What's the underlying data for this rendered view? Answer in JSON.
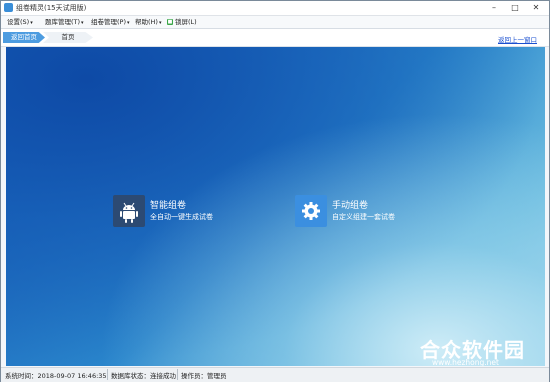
{
  "window": {
    "title": "组卷精灵(15天试用版)",
    "min_glyph": "–",
    "max_glyph": "□",
    "close_glyph": "✕"
  },
  "menu": [
    {
      "label": "设置(S)",
      "arrow": "▾"
    },
    {
      "label": "题库管理(T)",
      "arrow": "▾"
    },
    {
      "label": "组卷管理(P)",
      "arrow": "▾"
    },
    {
      "label": "帮助(H)",
      "arrow": "▾"
    },
    {
      "label": "锁屏(L)",
      "icon": "lock-icon"
    }
  ],
  "nav": {
    "home_crumb": "返回首页",
    "current_crumb": "首页",
    "back_link": "返回上一窗口"
  },
  "tiles": [
    {
      "title": "智能组卷",
      "subtitle": "全自动一键生成试卷",
      "icon": "android-icon",
      "color": "#2c4a73"
    },
    {
      "title": "手动组卷",
      "subtitle": "自定义组建一套试卷",
      "icon": "gear-icon",
      "color": "#3b8fe0"
    }
  ],
  "watermark": {
    "text": "合众软件园",
    "url": "www.hezhong.net"
  },
  "status": {
    "time_label": "系统时间：2018-09-07 16:46:35",
    "db_label": "数据库状态：连接成功",
    "operator_label": "操作员：管理员"
  },
  "colors": {
    "accent": "#4d9ce0",
    "link": "#1a4fd0"
  }
}
